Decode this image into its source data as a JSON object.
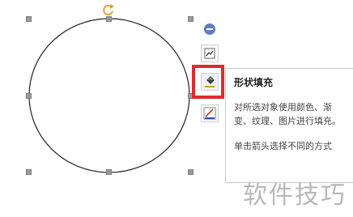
{
  "toolbar": {
    "collapse_icon": "minus-circle-icon",
    "buttons": [
      {
        "name": "layout-options-button",
        "icon": "image-layout-icon"
      },
      {
        "name": "shape-fill-button",
        "icon": "paint-bucket-icon",
        "highlighted": true
      },
      {
        "name": "shape-outline-button",
        "icon": "pen-outline-icon"
      }
    ],
    "highlight_color": "#e02b2b"
  },
  "tooltip": {
    "title": "形状填充",
    "description": "对所选对象使用颜色、渐变、纹理、图片进行填充。",
    "hint": "单击箭头选择不同的方式"
  },
  "shape": {
    "type": "circle",
    "rotate_icon": "rotate-icon",
    "rotate_color": "#e8a030"
  },
  "watermark": {
    "text": "软件技巧"
  }
}
